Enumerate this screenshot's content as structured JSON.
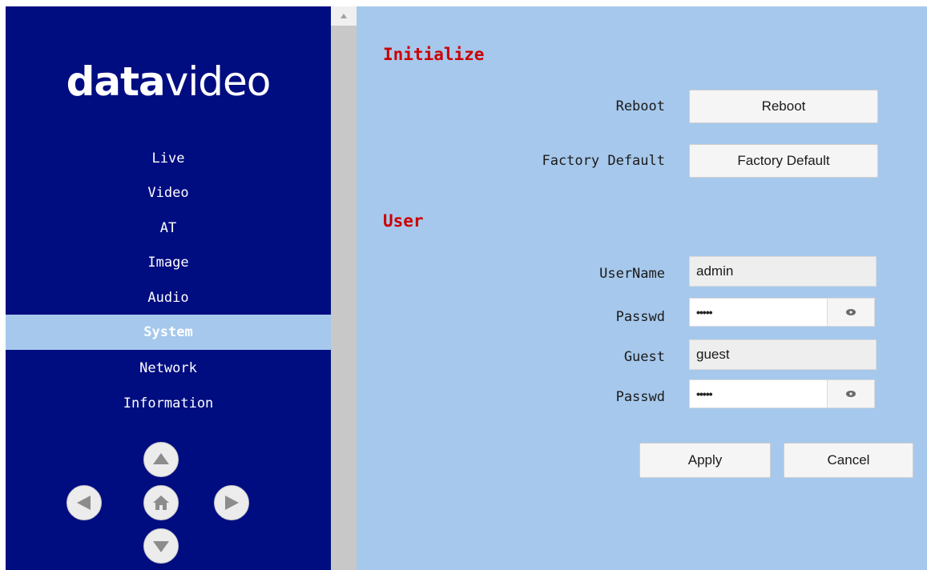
{
  "sidebar": {
    "logo": {
      "bold_part": "data",
      "light_part": "video"
    },
    "nav": [
      {
        "label": "Live",
        "active": false
      },
      {
        "label": "Video",
        "active": false
      },
      {
        "label": "AT",
        "active": false
      },
      {
        "label": "Image",
        "active": false
      },
      {
        "label": "Audio",
        "active": false
      },
      {
        "label": "System",
        "active": true
      },
      {
        "label": "Network",
        "active": false
      },
      {
        "label": "Information",
        "active": false
      }
    ],
    "dpad_icons": [
      "arrow-up-icon",
      "arrow-left-icon",
      "home-icon",
      "arrow-right-icon",
      "arrow-down-icon"
    ]
  },
  "initialize": {
    "title": "Initialize",
    "reboot_label": "Reboot",
    "reboot_button": "Reboot",
    "factory_label": "Factory Default",
    "factory_button": "Factory Default"
  },
  "user": {
    "title": "User",
    "username_label": "UserName",
    "username_value": "admin",
    "passwd_label": "Passwd",
    "passwd_value": "•••••",
    "guest_label": "Guest",
    "guest_value": "guest",
    "guest_passwd_label": "Passwd",
    "guest_passwd_value": "•••••"
  },
  "actions": {
    "apply": "Apply",
    "cancel": "Cancel"
  },
  "colors": {
    "sidebar_bg": "#000d80",
    "main_bg": "#a6c8ec",
    "section_title": "#cc0000",
    "active_nav_bg": "#a6c8ec"
  }
}
